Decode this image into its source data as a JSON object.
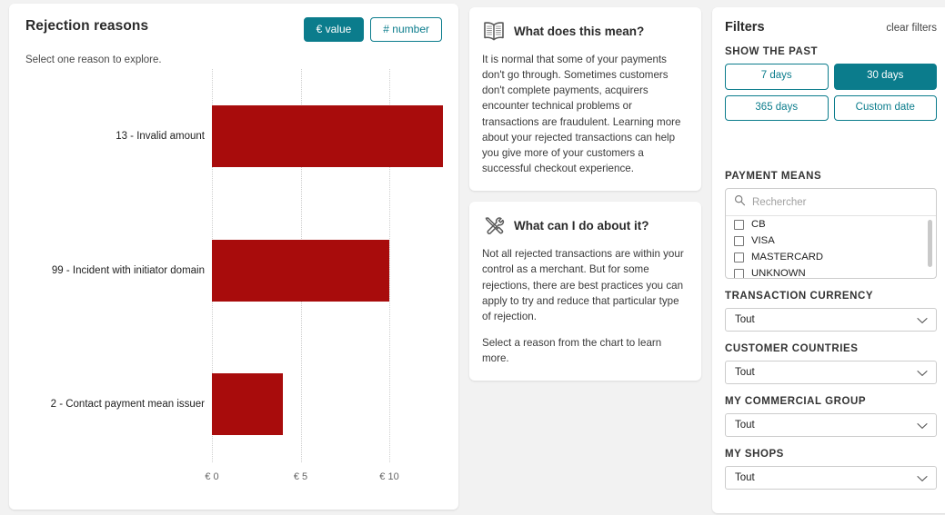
{
  "chart_panel": {
    "title": "Rejection reasons",
    "subtitle": "Select one reason to explore.",
    "toggles": [
      {
        "label": "€ value",
        "active": true,
        "name": "value-toggle"
      },
      {
        "label": "# number",
        "active": false,
        "name": "number-toggle"
      }
    ]
  },
  "chart_data": {
    "type": "bar",
    "orientation": "horizontal",
    "title": "Rejection reasons",
    "categories": [
      "13 - Invalid amount",
      "99 - Incident with initiator domain",
      "2 - Contact payment mean issuer"
    ],
    "values": [
      13,
      10,
      4
    ],
    "tick_labels": [
      "€ 0",
      "€ 5",
      "€ 10"
    ],
    "tick_values": [
      0,
      5,
      10
    ],
    "xlabel": "",
    "ylabel": "",
    "xlim": [
      0,
      13.5
    ],
    "grid": true,
    "legend": "none",
    "bar_color": "#a80c0c",
    "unit": "€"
  },
  "info_cards": [
    {
      "icon": "book-icon",
      "title": "What does this mean?",
      "paragraphs": [
        "It is normal that some of your payments don't go through. Sometimes customers don't complete payments, acquirers encounter technical problems or transactions are fraudulent. Learning more about your rejected transactions can help you give more of your customers a successful checkout experience."
      ]
    },
    {
      "icon": "tools-icon",
      "title": "What can I do about it?",
      "paragraphs": [
        "Not all rejected transactions are within your control as a merchant. But for some rejections, there are best practices you can apply to try and reduce that particular type of rejection.",
        "Select a reason from the chart to learn more."
      ]
    }
  ],
  "filters": {
    "title": "Filters",
    "clear_label": "clear filters",
    "date_section_label": "SHOW THE PAST",
    "date_buttons": [
      {
        "label": "7 days",
        "active": false
      },
      {
        "label": "30 days",
        "active": true
      },
      {
        "label": "365 days",
        "active": false
      },
      {
        "label": "Custom date",
        "active": false
      }
    ],
    "payment_means": {
      "label": "PAYMENT MEANS",
      "search_placeholder": "Rechercher",
      "search_value": "",
      "options": [
        {
          "label": "CB",
          "checked": false
        },
        {
          "label": "VISA",
          "checked": false
        },
        {
          "label": "MASTERCARD",
          "checked": false
        },
        {
          "label": "UNKNOWN",
          "checked": false
        }
      ]
    },
    "selects": [
      {
        "label": "TRANSACTION CURRENCY",
        "value": "Tout"
      },
      {
        "label": "CUSTOMER COUNTRIES",
        "value": "Tout"
      },
      {
        "label": "MY COMMERCIAL GROUP",
        "value": "Tout"
      },
      {
        "label": "MY SHOPS",
        "value": "Tout"
      }
    ]
  },
  "colors": {
    "accent_teal": "#0b7c8c",
    "bar_red": "#a80c0c",
    "page_bg": "#f2f2f2"
  }
}
